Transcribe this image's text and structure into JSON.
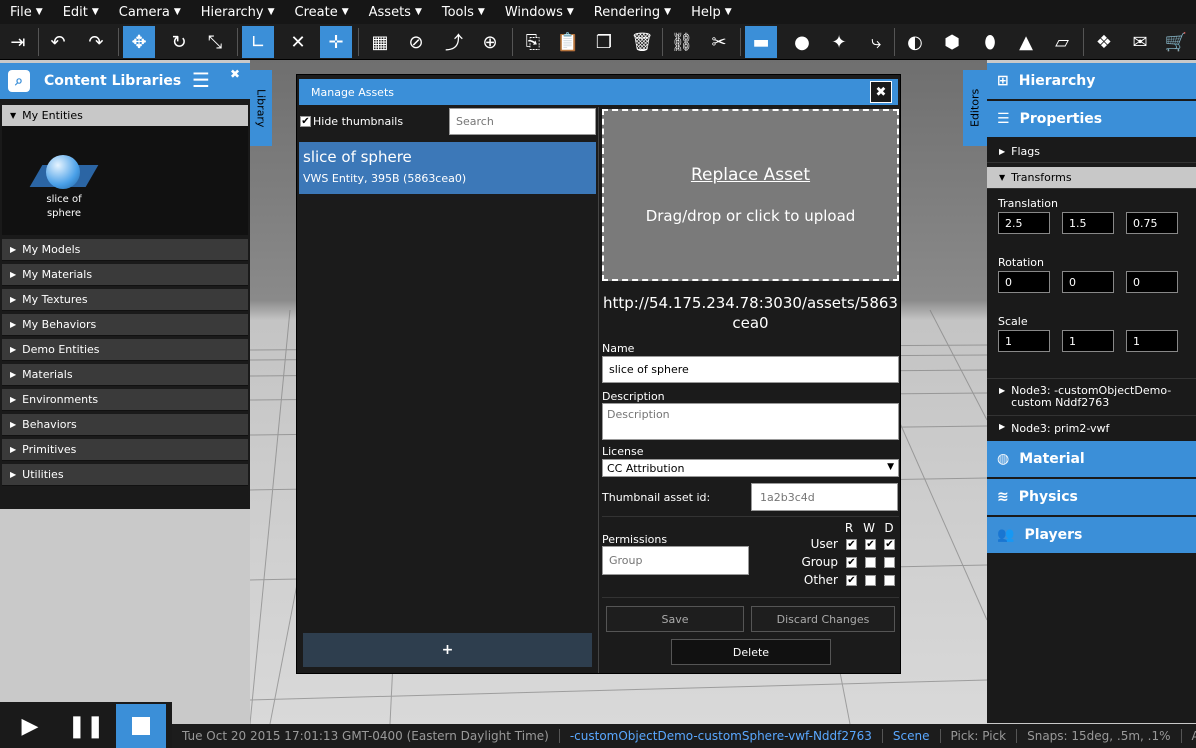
{
  "menu": [
    "File",
    "Edit",
    "Camera",
    "Hierarchy",
    "Create",
    "Assets",
    "Tools",
    "Windows",
    "Rendering",
    "Help"
  ],
  "left": {
    "title": "Content Libraries",
    "tab_label": "Library",
    "open_section": "My Entities",
    "entity_label": "slice of sphere",
    "sections": [
      "My Models",
      "My Materials",
      "My Textures",
      "My Behaviors",
      "Demo Entities",
      "Materials",
      "Environments",
      "Behaviors",
      "Primitives",
      "Utilities"
    ]
  },
  "right": {
    "tab_label": "Editors",
    "hierarchy": "Hierarchy",
    "properties": "Properties",
    "flags": "Flags",
    "transforms": "Transforms",
    "translation_label": "Translation",
    "translation": [
      "2.5",
      "1.5",
      "0.75"
    ],
    "rotation_label": "Rotation",
    "rotation": [
      "0",
      "0",
      "0"
    ],
    "scale_label": "Scale",
    "scale": [
      "1",
      "1",
      "1"
    ],
    "node1": "Node3: -customObjectDemo-custom Nddf2763",
    "node2": "Node3: prim2-vwf",
    "material": "Material",
    "physics": "Physics",
    "players": "Players"
  },
  "dialog": {
    "title": "Manage Assets",
    "close": "✖",
    "hide_thumbnails": "Hide thumbnails",
    "search_placeholder": "Search",
    "asset_name": "slice of sphere",
    "asset_meta": "VWS Entity, 395B (5863cea0)",
    "add": "+",
    "replace_title": "Replace Asset",
    "replace_hint": "Drag/drop or click to upload",
    "url": "http://54.175.234.78:3030/assets/5863cea0",
    "name_label": "Name",
    "name_value": "slice of sphere",
    "desc_label": "Description",
    "desc_placeholder": "Description",
    "license_label": "License",
    "license_value": "CC Attribution",
    "thumb_label": "Thumbnail asset id:",
    "thumb_placeholder": "1a2b3c4d",
    "perm_label": "Permissions",
    "group_placeholder": "Group",
    "perm_cols": [
      "R",
      "W",
      "D"
    ],
    "perm_rows": [
      {
        "label": "User",
        "r": true,
        "w": true,
        "d": true
      },
      {
        "label": "Group",
        "r": true,
        "w": false,
        "d": false
      },
      {
        "label": "Other",
        "r": true,
        "w": false,
        "d": false
      }
    ],
    "save": "Save",
    "discard": "Discard Changes",
    "delete": "Delete"
  },
  "status": {
    "time": "Tue Oct 20 2015 17:01:13 GMT-0400 (Eastern Daylight Time)",
    "node": "-customObjectDemo-customSphere-vwf-Nddf2763",
    "mode": "Scene",
    "pick": "Pick: Pick",
    "snaps": "Snaps: 15deg, .5m, .1%",
    "axis": "Axis: -"
  },
  "colors": {
    "accent": "#3b8fd8",
    "panel": "#1a1a1a"
  }
}
